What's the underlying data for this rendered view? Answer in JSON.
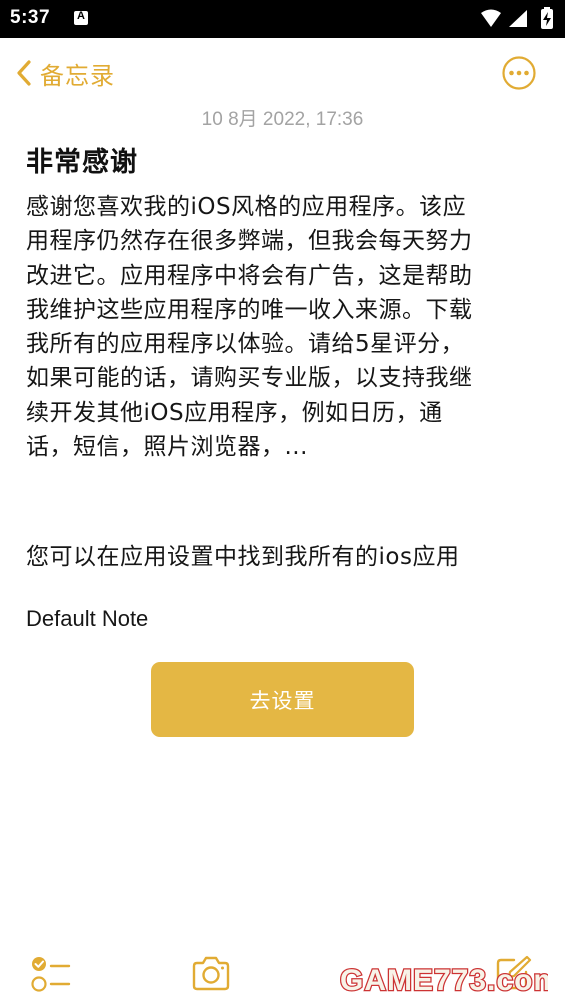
{
  "status_bar": {
    "time": "5:37",
    "notification_icon": "a-icon",
    "icons": [
      "wifi-icon",
      "signal-icon",
      "battery-charging-icon"
    ]
  },
  "nav": {
    "back_label": "备忘录",
    "back_icon": "chevron-left-icon",
    "more_icon": "more-circle-icon"
  },
  "note": {
    "date": "10 8月 2022, 17:36",
    "title": "非常感谢",
    "body_lines": [
      "感谢您喜欢我的iOS风格的应用程序。该应",
      "用程序仍然存在很多弊端，但我会每天努力",
      "改进它。应用程序中将会有广告，这是帮助",
      "我维护这些应用程序的唯一收入来源。下载",
      "我所有的应用程序以体验。请给5星评分，",
      "如果可能的话，请购买专业版，以支持我继",
      "续开发其他iOS应用程序，例如日历，通",
      "话，短信，照片浏览器，..."
    ],
    "settings_hint": "您可以在应用设置中找到我所有的ios应用",
    "default_note": "Default Note",
    "settings_button": "去设置"
  },
  "toolbar": {
    "icons": [
      "checklist-icon",
      "camera-icon",
      "compose-icon"
    ]
  },
  "watermark": {
    "text": "GAME773.com"
  },
  "colors": {
    "accent": "#e1ab33",
    "button_bg": "#e4b744",
    "date_text": "#a3a3a3",
    "status_bar_bg": "#000000"
  }
}
